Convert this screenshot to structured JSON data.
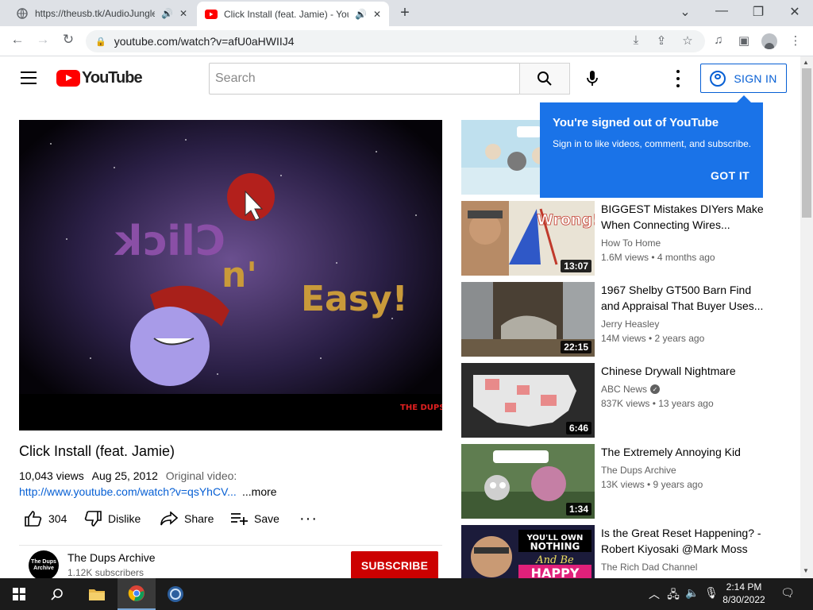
{
  "browser": {
    "tabs": [
      {
        "title": "https://theusb.tk/AudioJungle",
        "active": false
      },
      {
        "title": "Click Install (feat. Jamie) - YouTube",
        "active": true
      }
    ],
    "url": "youtube.com/watch?v=afU0aHWIIJ4"
  },
  "youtube": {
    "logo_text": "YouTube",
    "search_placeholder": "Search",
    "sign_in_label": "SIGN IN"
  },
  "popup": {
    "title": "You're signed out of YouTube",
    "body": "Sign in to like videos, comment, and subscribe.",
    "button": "GOT IT"
  },
  "video": {
    "title": "Click Install (feat. Jamie)",
    "views": "10,043 views",
    "date": "Aug 25, 2012",
    "original_label": "Original video:",
    "link": "http://www.youtube.com/watch?v=qsYhCV...",
    "more": "...more",
    "likes": "304",
    "dislike_label": "Dislike",
    "share_label": "Share",
    "save_label": "Save",
    "watermark": "THE DUPS",
    "frame_text_1": "Click",
    "frame_text_2": "n'",
    "frame_text_3": "Easy!"
  },
  "channel": {
    "name": "The Dups Archive",
    "subscribers": "1.12K subscribers",
    "avatar_text": "The Dups Archive",
    "subscribe_label": "SUBSCRIBE"
  },
  "recommendations": [
    {
      "title": "",
      "channel": "",
      "stats": "",
      "duration": "",
      "thumb_color": "#9cc8e0"
    },
    {
      "title": "BIGGEST Mistakes DIYers Make When Connecting Wires...",
      "channel": "How To Home",
      "stats": "1.6M views • 4 months ago",
      "duration": "13:07",
      "thumb_text": "Wrong!",
      "thumb_color": "#e9e3d5"
    },
    {
      "title": "1967 Shelby GT500 Barn Find and Appraisal That Buyer Uses...",
      "channel": "Jerry Heasley",
      "stats": "14M views • 2 years ago",
      "duration": "22:15",
      "thumb_color": "#5a5246"
    },
    {
      "title": "Chinese Drywall Nightmare",
      "channel": "ABC News",
      "stats": "837K views • 13 years ago",
      "duration": "6:46",
      "thumb_color": "#2c2c2c"
    },
    {
      "title": "The Extremely Annoying Kid",
      "channel": "The Dups Archive",
      "stats": "13K views • 9 years ago",
      "duration": "1:34",
      "thumb_color": "#6c8a5a"
    },
    {
      "title": "Is the Great Reset Happening? - Robert Kiyosaki @Mark Moss",
      "channel": "The Rich Dad Channel",
      "stats": "",
      "duration": "",
      "thumb_text_1": "YOU'LL OWN",
      "thumb_text_2": "NOTHING",
      "thumb_text_3": "And Be",
      "thumb_text_4": "HAPPY",
      "thumb_color": "#1b1b3a"
    }
  ],
  "taskbar": {
    "time": "2:14 PM",
    "date": "8/30/2022"
  }
}
